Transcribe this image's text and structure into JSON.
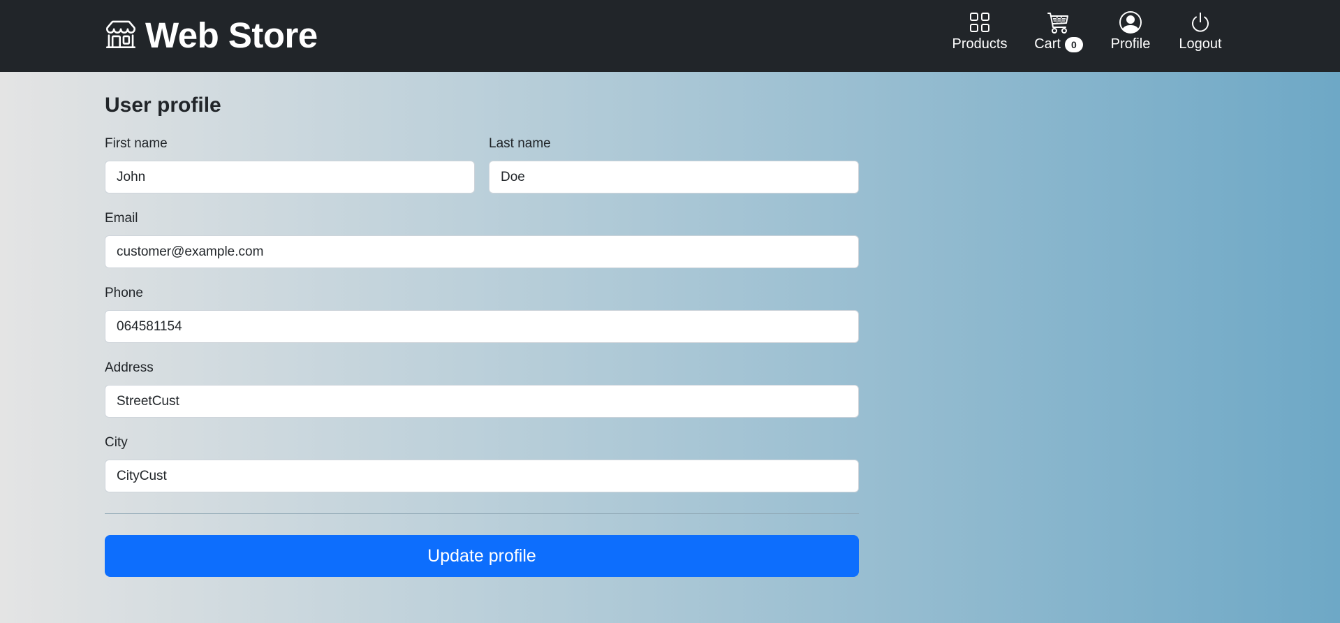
{
  "navbar": {
    "brand": "Web Store",
    "brand_icon": "shop-icon",
    "items": [
      {
        "label": "Products",
        "icon": "grid-icon"
      },
      {
        "label": "Cart",
        "icon": "cart-icon",
        "badge": "0"
      },
      {
        "label": "Profile",
        "icon": "person-circle-icon"
      },
      {
        "label": "Logout",
        "icon": "power-icon"
      }
    ]
  },
  "form": {
    "title": "User profile",
    "fields": {
      "first_name": {
        "label": "First name",
        "value": "John"
      },
      "last_name": {
        "label": "Last name",
        "value": "Doe"
      },
      "email": {
        "label": "Email",
        "value": "customer@example.com"
      },
      "phone": {
        "label": "Phone",
        "value": "064581154"
      },
      "address": {
        "label": "Address",
        "value": "StreetCust"
      },
      "city": {
        "label": "City",
        "value": "CityCust"
      }
    },
    "submit_label": "Update profile"
  },
  "colors": {
    "navbar": "#212529",
    "primary": "#0d6efd",
    "gradient_start": "#e4e4e4",
    "gradient_end": "#6ea8c6"
  }
}
